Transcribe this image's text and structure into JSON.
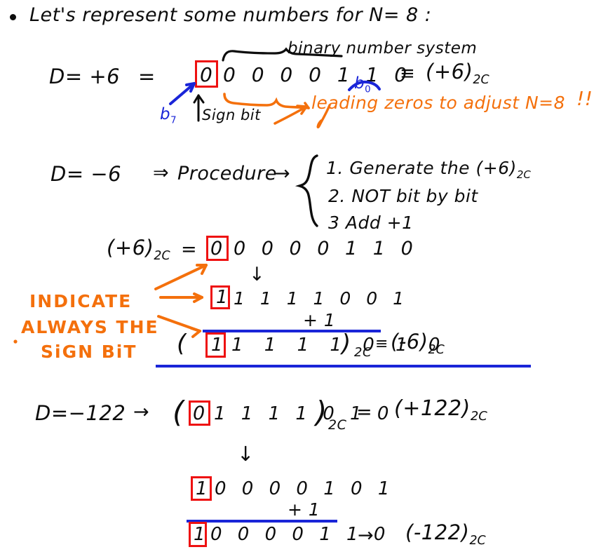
{
  "page": {
    "title": "Two's complement representation handwritten notes",
    "ink_colors": {
      "black": "#0d0d0d",
      "blue": "#1a25d8",
      "orange": "#f4700c",
      "red": "#ee1111"
    },
    "background": "#ffffff"
  },
  "intro": {
    "bullet_text": "Let's   represent  some  numbers   for  N= 8 :"
  },
  "example_positive": {
    "lhs": "D= +6",
    "equals": "=",
    "sign_bit": "0",
    "magnitude_bits": "0 0 0 0 1 1 0",
    "brace_label": "binary number system",
    "lsb_label": "b",
    "lsb_index": "0",
    "msb_label": "b",
    "msb_index": "7",
    "sign_bit_label": "Sign bit",
    "equiv_symbol": "≡",
    "equiv_value": "(+6)",
    "equiv_sub": "2C",
    "orange_note": "leading zeros to adjust N=8",
    "orange_bangs": "!!"
  },
  "example_negative": {
    "lhs": "D= −6",
    "implies": "⇒",
    "procedure_label": "Procedure",
    "arrow": "→",
    "steps": [
      {
        "num": "1.",
        "text": "Generate the",
        "tail": "(+6)",
        "tail_sub": "2C"
      },
      {
        "num": "2.",
        "text": "NOT bit by bit",
        "tail": "",
        "tail_sub": ""
      },
      {
        "num": "3",
        "text": "Add +1",
        "tail": "",
        "tail_sub": ""
      }
    ]
  },
  "work_six": {
    "source_label": "(+6)",
    "source_sub": "2C",
    "equals": "=",
    "source_sign_bit": "0",
    "source_bits": "0 0 0 0 1 1 0",
    "down_arrow": "↓",
    "not_sign_bit": "1",
    "not_bits": "1 1 1 1 0 0 1",
    "add_one": "+ 1",
    "open_paren": "(",
    "result_sign_bit": "1",
    "result_bits": "1 1 1 1 0 1 0",
    "close_paren": ")",
    "result_sub": "2C",
    "equiv_symbol": "≡",
    "result_value": "(-6)",
    "result_value_sub": "2C"
  },
  "annotation": {
    "line1": "INDICATE",
    "line2": "ALWAYS THE",
    "line3": "SiGN BiT"
  },
  "example_122": {
    "lhs": "D=−122",
    "arrow": "→",
    "open_paren": "(",
    "sign_bit": "0",
    "bits": "1 1 1 1 0 1 0",
    "close_paren": ")",
    "sub": "2C",
    "equals": "=",
    "rhs_value": "(+122)",
    "rhs_sub": "2C",
    "down_arrow": "↓",
    "not_sign_bit": "1",
    "not_bits": "0 0 0 0 1 0 1",
    "add_one": "+ 1",
    "result_sign_bit": "1",
    "result_bits": "0 0 0 0 1 1 0",
    "result_arrow": "→",
    "result_value": "(-122)",
    "result_sub": "2C"
  }
}
